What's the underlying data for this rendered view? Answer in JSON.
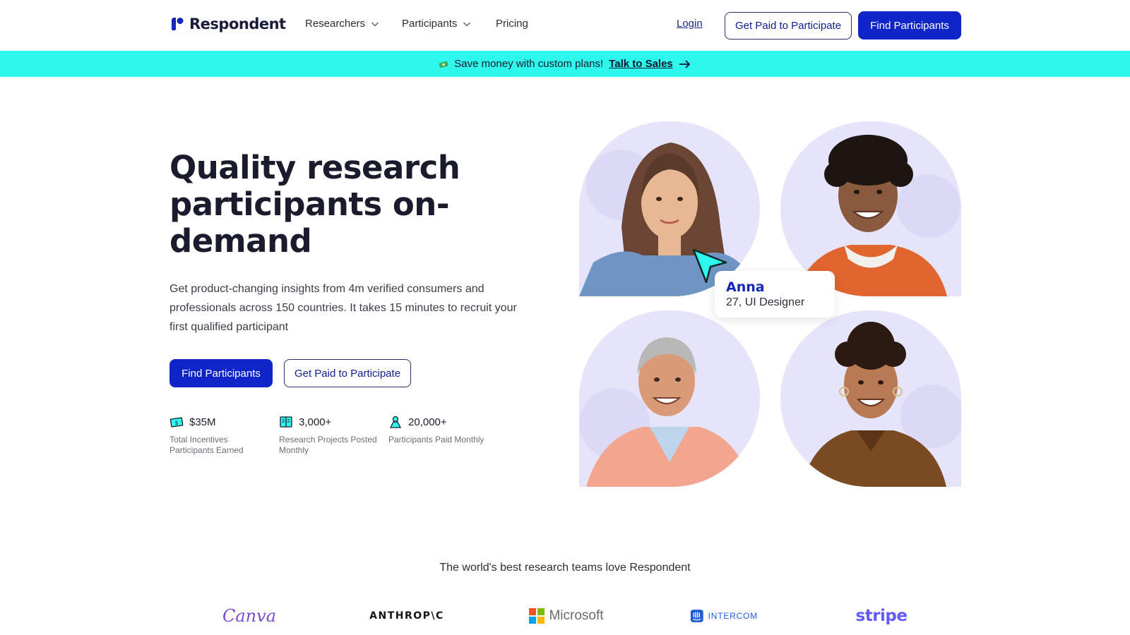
{
  "nav": {
    "logo_text": "Respondent",
    "researchers": "Researchers",
    "participants": "Participants",
    "pricing": "Pricing",
    "login": "Login",
    "get_paid": "Get Paid to Participate",
    "find_participants": "Find Participants"
  },
  "banner": {
    "text": "Save money with custom plans!",
    "link": "Talk to Sales"
  },
  "hero": {
    "title": "Quality research participants on-demand",
    "subtitle": "Get product-changing insights from 4m verified consumers and professionals across 150 countries. It takes 15 minutes to recruit your first qualified participant",
    "cta_primary": "Find Participants",
    "cta_secondary": "Get Paid to Participate"
  },
  "stats": [
    {
      "value": "$35M",
      "label": "Total Incentives Participants Earned",
      "icon": "money-icon"
    },
    {
      "value": "3,000+",
      "label": "Research Projects Posted Monthly",
      "icon": "book-icon"
    },
    {
      "value": "20,000+",
      "label": "Participants Paid Monthly",
      "icon": "person-icon"
    }
  ],
  "name_card": {
    "name": "Anna",
    "role": "27, UI Designer"
  },
  "logos": {
    "title": "The world's best research teams love Respondent",
    "brands": [
      "Canva",
      "ANTHROP\\C",
      "Microsoft",
      "INTERCOM",
      "stripe"
    ]
  },
  "colors": {
    "primary": "#0f25c8",
    "banner": "#2ef7ee",
    "portrait_bg": "#e6e4fb",
    "text_dark": "#1a1c2e"
  }
}
